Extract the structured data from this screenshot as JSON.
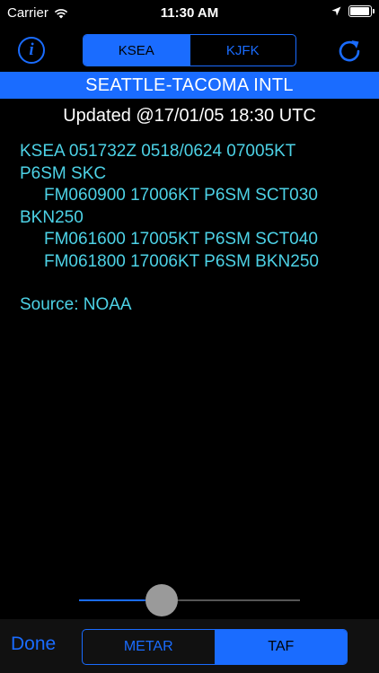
{
  "status_bar": {
    "carrier": "Carrier",
    "time": "11:30 AM"
  },
  "nav": {
    "info_label": "i",
    "stations": [
      {
        "label": "KSEA",
        "active": true
      },
      {
        "label": "KJFK",
        "active": false
      }
    ]
  },
  "banner": {
    "station_name": "SEATTLE-TACOMA INTL"
  },
  "report": {
    "updated": "Updated @17/01/05 18:30 UTC",
    "lines": [
      "KSEA 051732Z 0518/0624 07005KT",
      "P6SM SKC",
      "FM060900 17006KT P6SM SCT030",
      "BKN250",
      "FM061600 17005KT P6SM SCT040",
      "FM061800 17006KT P6SM BKN250"
    ],
    "source": "Source: NOAA"
  },
  "slider": {
    "value": 0.35
  },
  "toolbar": {
    "done_label": "Done",
    "modes": [
      {
        "label": "METAR",
        "active": false
      },
      {
        "label": "TAF",
        "active": true
      }
    ]
  },
  "colors": {
    "accent": "#1a6cff",
    "report_text": "#4dd2e6"
  }
}
